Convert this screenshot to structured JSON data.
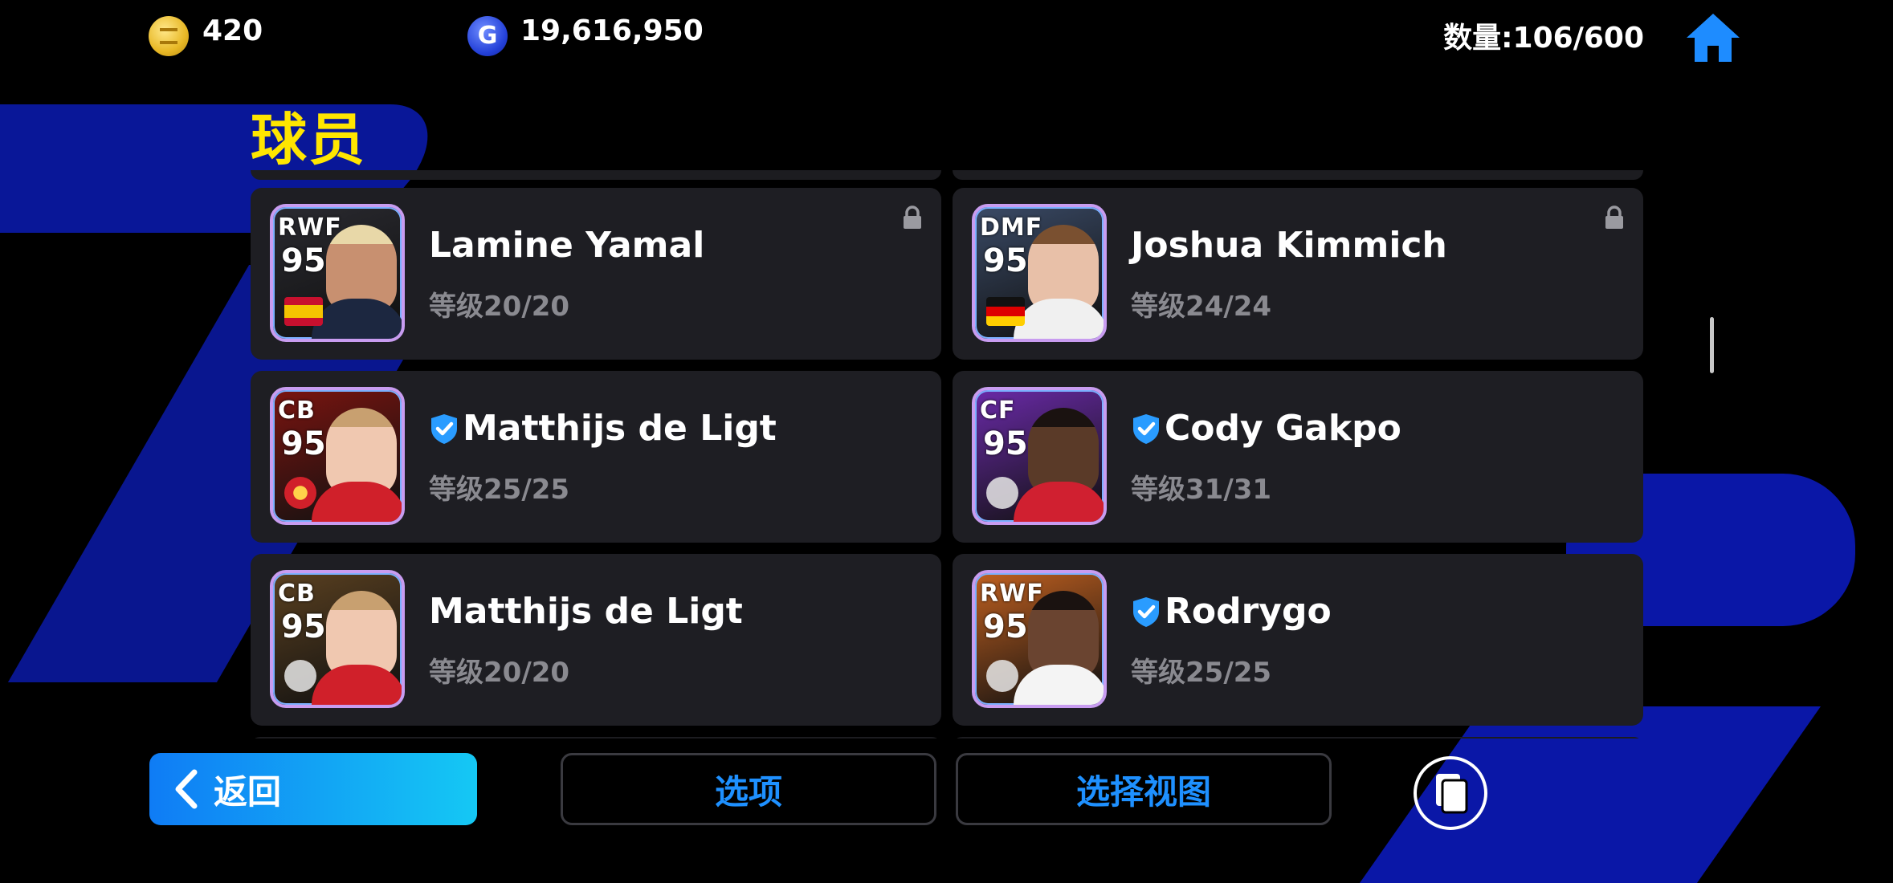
{
  "currency": {
    "coins": "420",
    "gp": "19,616,950",
    "coin_icon": "efootball-coin-icon",
    "gp_icon": "gp-icon",
    "gp_glyph": "G"
  },
  "inventory_count": "数量:106/600",
  "page_title": "球员",
  "players": [
    {
      "position": "RWF",
      "rating": "95",
      "name": "Lamine Yamal",
      "level": "等级20/20",
      "verified": false,
      "locked": true,
      "skin": "#c89070",
      "hair": "#e8d8a8",
      "shirt": "#1c2740",
      "bg": "#2a2a30",
      "badge": "spain-flag"
    },
    {
      "position": "DMF",
      "rating": "95",
      "name": "Joshua Kimmich",
      "level": "等级24/24",
      "verified": false,
      "locked": true,
      "skin": "#e8c0a8",
      "hair": "#7a5030",
      "shirt": "#f0f0f0",
      "bg": "#3a4a66",
      "badge": "germany-flag"
    },
    {
      "position": "CB",
      "rating": "95",
      "name": "Matthijs de Ligt",
      "level": "等级25/25",
      "verified": true,
      "locked": false,
      "skin": "#f0c8b0",
      "hair": "#c8a070",
      "shirt": "#d0202a",
      "bg": "#7a1410",
      "badge": "man-utd-crest"
    },
    {
      "position": "CF",
      "rating": "95",
      "name": "Cody Gakpo",
      "level": "等级31/31",
      "verified": true,
      "locked": false,
      "skin": "#5a3a28",
      "hair": "#1a1210",
      "shirt": "#d02030",
      "bg": "#6a2aa8",
      "badge": "club-crest"
    },
    {
      "position": "CB",
      "rating": "95",
      "name": "Matthijs de Ligt",
      "level": "等级20/20",
      "verified": false,
      "locked": false,
      "skin": "#f0c8b0",
      "hair": "#c8a070",
      "shirt": "#d0202a",
      "bg": "#5a4020",
      "badge": "club-crest"
    },
    {
      "position": "RWF",
      "rating": "95",
      "name": "Rodrygo",
      "level": "等级25/25",
      "verified": true,
      "locked": false,
      "skin": "#6a4430",
      "hair": "#1a1210",
      "shirt": "#f4f4f4",
      "bg": "#c06020",
      "badge": "club-crest"
    }
  ],
  "buttons": {
    "back": "返回",
    "options": "选项",
    "select_view": "选择视图"
  },
  "colors": {
    "title": "#ffe600",
    "accent_blue": "#1e90ff",
    "card_bg": "#1e1e23",
    "background": "#000000"
  }
}
